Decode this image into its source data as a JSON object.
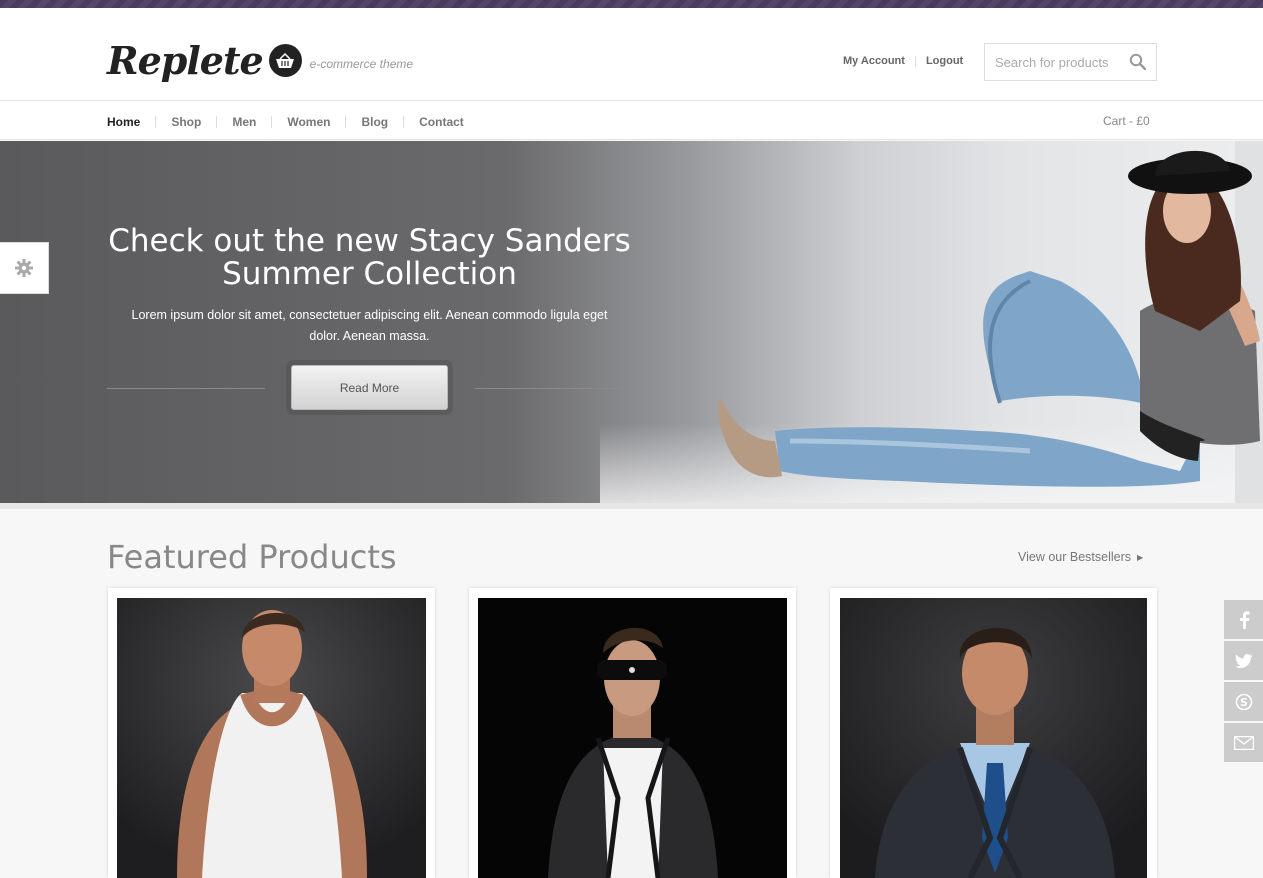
{
  "header": {
    "logo_text": "Replete",
    "logo_tagline": "e-commerce theme",
    "my_account": "My Account",
    "logout": "Logout",
    "search_placeholder": "Search for products",
    "search_icon": "magnifier-icon"
  },
  "nav": {
    "items": [
      "Home",
      "Shop",
      "Men",
      "Women",
      "Blog",
      "Contact"
    ],
    "active": "Home",
    "cart_label": "Cart - £0"
  },
  "hero": {
    "title_line1": "Check out the new Stacy Sanders",
    "title_line2": "Summer Collection",
    "description_line1": "Lorem ipsum dolor sit amet, consectetuer adipiscing elit. Aenean commodo ligula eget",
    "description_line2": "dolor. Aenean massa.",
    "button_label": "Read More"
  },
  "featured": {
    "title": "Featured Products",
    "bestsellers_link": "View our Bestsellers",
    "products": [
      {
        "image": "man-in-white-tank-top"
      },
      {
        "image": "man-in-sunglasses-leather-jacket"
      },
      {
        "image": "man-in-suit-blue-tie"
      }
    ]
  },
  "social": [
    "facebook-icon",
    "twitter-icon",
    "skype-icon",
    "email-icon"
  ],
  "colors": {
    "top_stripe": "#4a3a5c",
    "social_bg": "#cccccc",
    "accent_text": "#222222"
  }
}
